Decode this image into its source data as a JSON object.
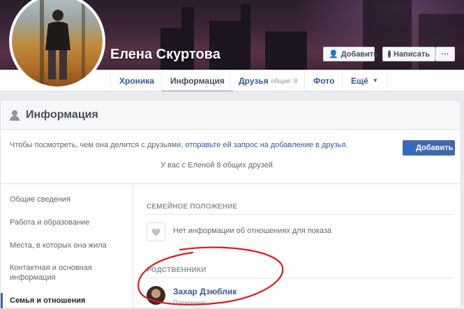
{
  "profile": {
    "name": "Елена Скуртова",
    "add_friend_label": "Добавить",
    "message_label": "Написать",
    "more_dots": "···"
  },
  "tabs": [
    {
      "label": "Хроника"
    },
    {
      "label": "Информация"
    },
    {
      "label": "Друзья",
      "extra": "общие: 8"
    },
    {
      "label": "Фото"
    },
    {
      "label": "Ещё"
    }
  ],
  "info": {
    "title": "Информация",
    "notice_text": "Чтобы посмотреть, чем она делится с друзьями, ",
    "notice_link": "отправьте ей запрос на добавление в друзья",
    "notice_end": ".",
    "add_button": "Добавить",
    "mutual_friends": "У вас с Еленой 8 общих друзей"
  },
  "sidebar": {
    "items": [
      {
        "label": "Общие сведения"
      },
      {
        "label": "Работа и образование"
      },
      {
        "label": "Места, в которых она жила"
      },
      {
        "label": "Контактная и основная информация"
      },
      {
        "label": "Семья и отношения"
      }
    ]
  },
  "relationship": {
    "heading": "СЕМЕЙНОЕ ПОЛОЖЕНИЕ",
    "empty_text": "Нет информации об отношениях для показа"
  },
  "relatives": {
    "heading": "РОДСТВЕННИКИ",
    "items": [
      {
        "name": "Захар Дзюблик",
        "relation": "Племянник"
      }
    ]
  },
  "colors": {
    "link": "#365899",
    "primary": "#4267b2",
    "annotation": "#e0191c"
  }
}
